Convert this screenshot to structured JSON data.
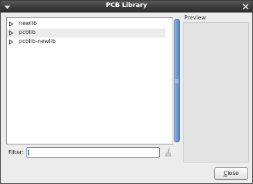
{
  "window": {
    "title": "PCB Library"
  },
  "libraries": [
    {
      "label": "newlib",
      "selected": false
    },
    {
      "label": "pcblib",
      "selected": true
    },
    {
      "label": "pcblib-newlib",
      "selected": false
    }
  ],
  "filter": {
    "label": "Filter:",
    "value": ""
  },
  "preview": {
    "label": "Preview"
  },
  "buttons": {
    "close_mnemonic": "C",
    "close_rest": "lose"
  },
  "icons": {
    "title": "window-menu-icon",
    "close": "close-icon",
    "expander": "triangle-right-icon",
    "clear": "clear-brush-icon"
  }
}
